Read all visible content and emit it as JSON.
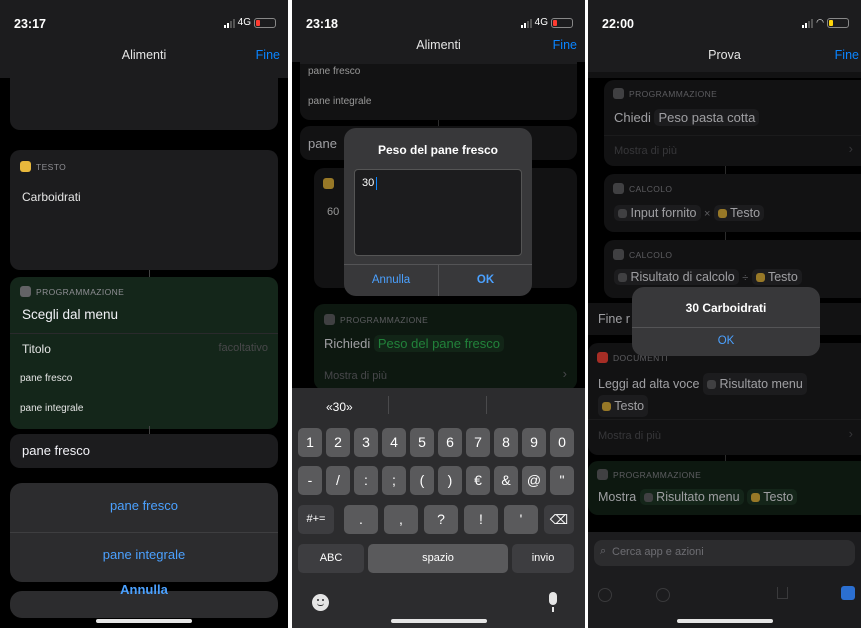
{
  "p1": {
    "time": "23:17",
    "network": "4G",
    "nav_title": "Alimenti",
    "done": "Fine",
    "testo_header": "TESTO",
    "testo_value": "Carboidrati",
    "prog_header": "PROGRAMMAZIONE",
    "menu_action": "Scegli dal menu",
    "titolo_label": "Titolo",
    "titolo_placeholder": "facoltativo",
    "items": [
      "pane fresco",
      "pane integrale"
    ],
    "section_label": "pane fresco",
    "sheet_options": [
      "pane fresco",
      "pane integrale"
    ],
    "cancel": "Annulla"
  },
  "p2": {
    "time": "23:18",
    "network": "4G",
    "nav_title": "Alimenti",
    "done": "Fine",
    "items": [
      "pane fresco",
      "pane integrale"
    ],
    "section_partial": "pane",
    "bg_number": "60",
    "alert_title": "Peso del pane fresco",
    "input_value": "30",
    "alert_cancel": "Annulla",
    "alert_ok": "OK",
    "prog_header": "PROGRAMMAZIONE",
    "ask_verb": "Richiedi",
    "ask_param": "Peso del pane fresco",
    "show_more": "Mostra di più",
    "suggestion": "«30»",
    "kb_row1": [
      "1",
      "2",
      "3",
      "4",
      "5",
      "6",
      "7",
      "8",
      "9",
      "0"
    ],
    "kb_row2": [
      "-",
      "/",
      ":",
      ";",
      "(",
      ")",
      "€",
      "&",
      "@",
      "\""
    ],
    "kb_row3_switch": "#+=",
    "kb_row3": [
      ".",
      ",",
      "?",
      "!",
      "'"
    ],
    "kb_abc": "ABC",
    "kb_space": "spazio",
    "kb_return": "invio"
  },
  "p3": {
    "time": "22:00",
    "nav_title": "Prova",
    "done": "Fine",
    "prog_header": "PROGRAMMAZIONE",
    "ask_verb": "Chiedi",
    "ask_param": "Peso pasta cotta",
    "show_more": "Mostra di più",
    "calc_header": "CALCOLO",
    "calc1_input": "Input fornito",
    "calc1_op": "×",
    "calc1_var": "Testo",
    "calc2_result": "Risultato di calcolo",
    "calc2_op": "÷",
    "calc2_var": "Testo",
    "fine_partial": "Fine r",
    "alert_title": "30 Carboidrati",
    "alert_ok": "OK",
    "doc_header": "DOCUMENTI",
    "speak_action": "Leggi ad alta voce",
    "speak_var": "Risultato menu",
    "speak_var2": "Testo",
    "show_more2": "Mostra di più",
    "prog_header2": "PROGRAMMAZIONE",
    "show_action": "Mostra",
    "show_var": "Risultato menu",
    "show_var2": "Testo",
    "search_placeholder": "Cerca app e azioni"
  }
}
